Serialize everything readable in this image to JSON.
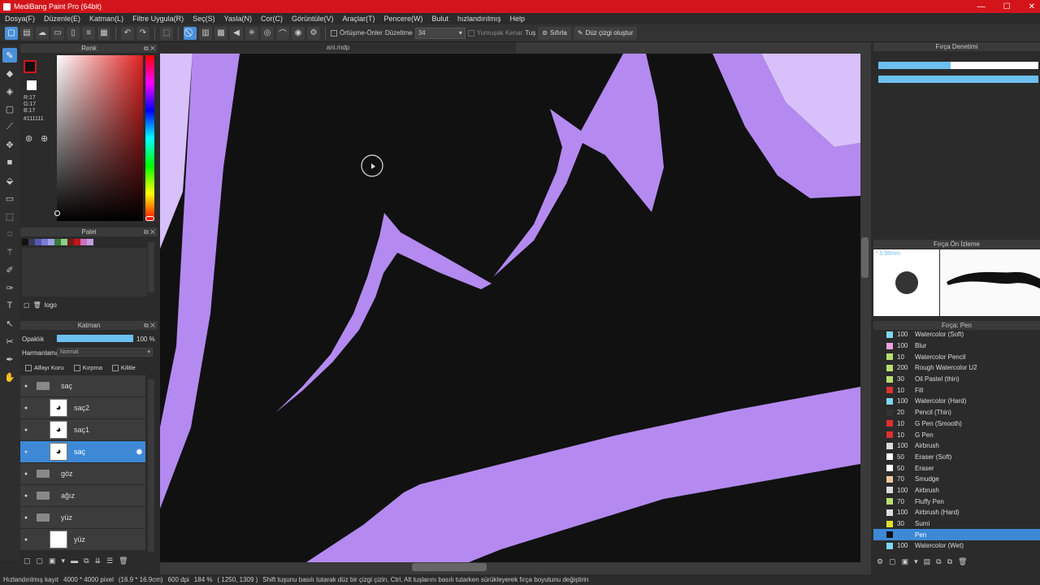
{
  "window": {
    "title": "MediBang Paint Pro (64bit)",
    "controls": [
      "—",
      "☐",
      "✕"
    ]
  },
  "menu": [
    "Dosya(F)",
    "Düzenle(E)",
    "Katman(L)",
    "Filtre Uygula(R)",
    "Seç(S)",
    "Yasla(N)",
    "Cor(C)",
    "Görüntüle(V)",
    "Araçlar(T)",
    "Pencere(W)",
    "Bulut",
    "hızlandırılmış",
    "Help"
  ],
  "toolbar": {
    "overlay_label": "Örtüşme-Önler",
    "correction_label": "Düzeltme",
    "correction_value": "34",
    "soft_edge_label": "Yumuşak Kenar",
    "tug_label": "Tuş",
    "reset_label": "Sıfırla",
    "line_label": "Düz çizgi oluştur"
  },
  "color_panel": {
    "title": "Renk",
    "r": "R:17",
    "g": "G:17",
    "b": "B:17",
    "hex": "#111111",
    "primary_color": "#111111",
    "accent": "#d3151b"
  },
  "palette_panel": {
    "title": "Palet",
    "colors": [
      "#111111",
      "#3a3a5a",
      "#5858b0",
      "#7b7bd8",
      "#a0a0e8",
      "#3a7a3a",
      "#8ad08a",
      "#7a1a1a",
      "#c01818",
      "#d070c0",
      "#c0a0e0"
    ],
    "palette_name": "logo"
  },
  "layer_panel": {
    "title": "Katman",
    "opacity_label": "Opaklık",
    "opacity_value": "100 %",
    "opacity_fraction": 1.0,
    "blend_label": "Harmanlama",
    "blend_value": "Normal",
    "alpha_lock": "Alfayı Koru",
    "clip": "Kırpma",
    "lock": "Kilitle",
    "layers": [
      {
        "name": "saç",
        "kind": "folder",
        "indent": false,
        "selected": false
      },
      {
        "name": "saç2",
        "kind": "layer",
        "indent": true,
        "selected": false
      },
      {
        "name": "saç1",
        "kind": "layer",
        "indent": true,
        "selected": false
      },
      {
        "name": "saç",
        "kind": "layer",
        "indent": true,
        "selected": true
      },
      {
        "name": "göz",
        "kind": "folder",
        "indent": false,
        "selected": false
      },
      {
        "name": "ağız",
        "kind": "folder",
        "indent": false,
        "selected": false
      },
      {
        "name": "yüz",
        "kind": "folder",
        "indent": false,
        "selected": false
      },
      {
        "name": "yüz",
        "kind": "layer",
        "indent": true,
        "selected": false
      }
    ]
  },
  "canvas": {
    "document_tab": "ani.mdp",
    "background": "#111111",
    "stroke_color": "#b48af0",
    "light_color": "#d8c0fa"
  },
  "brush_control": {
    "title": "Fırça Denetimi",
    "size_fraction": 0.45,
    "opacity_fraction": 1.0
  },
  "brush_preview": {
    "title": "Fırça Ön İzleme",
    "size": "* 0.96mm"
  },
  "brush_list": {
    "title": "Fırça: Pen",
    "items": [
      {
        "size": "100",
        "name": "Watercolor (Soft)",
        "color": "#7fd6f0"
      },
      {
        "size": "100",
        "name": "Blur",
        "color": "#f0a0e0"
      },
      {
        "size": "10",
        "name": "Watercolor Pencil",
        "color": "#b8e070"
      },
      {
        "size": "200",
        "name": "Rough Watercolor U2",
        "color": "#b8e070"
      },
      {
        "size": "30",
        "name": "Oil Pastel (thin)",
        "color": "#b8e070"
      },
      {
        "size": "10",
        "name": "Fill",
        "color": "#e03030"
      },
      {
        "size": "100",
        "name": "Watercolor (Hard)",
        "color": "#7fd6f0"
      },
      {
        "size": "20",
        "name": "Pencil (Thin)",
        "color": "#333333"
      },
      {
        "size": "10",
        "name": "G Pen (Smooth)",
        "color": "#e03030"
      },
      {
        "size": "10",
        "name": "G Pen",
        "color": "#e03030"
      },
      {
        "size": "100",
        "name": "Airbrush",
        "color": "#dddddd"
      },
      {
        "size": "50",
        "name": "Eraser (Soft)",
        "color": "#ffffff"
      },
      {
        "size": "50",
        "name": "Eraser",
        "color": "#ffffff"
      },
      {
        "size": "70",
        "name": "Smudge",
        "color": "#f0c8a0"
      },
      {
        "size": "100",
        "name": "Airbrush",
        "color": "#dddddd"
      },
      {
        "size": "70",
        "name": "Fluffy Pen",
        "color": "#b8e070"
      },
      {
        "size": "100",
        "name": "Airbrush (Hard)",
        "color": "#dddddd"
      },
      {
        "size": "30",
        "name": "Sumi",
        "color": "#e0e030"
      },
      {
        "size": "",
        "name": "Pen",
        "color": "#111111",
        "selected": true
      },
      {
        "size": "100",
        "name": "Watercolor (Wet)",
        "color": "#7fd6f0"
      }
    ]
  },
  "status": {
    "mode": "Hızlandırılmış kayıt",
    "size": "4000 * 4000 pixel",
    "cm": "(16.9 * 16.9cm)",
    "dpi": "600 dpi",
    "zoom": "184 %",
    "coords": "( 1250, 1309 )",
    "hint": "Shift tuşunu basılı tutarak düz bir çizgi çizin, Ctrl, Alt tuşlarını basılı tutarken sürükleyerek fırça boyutunu değiştirin"
  }
}
